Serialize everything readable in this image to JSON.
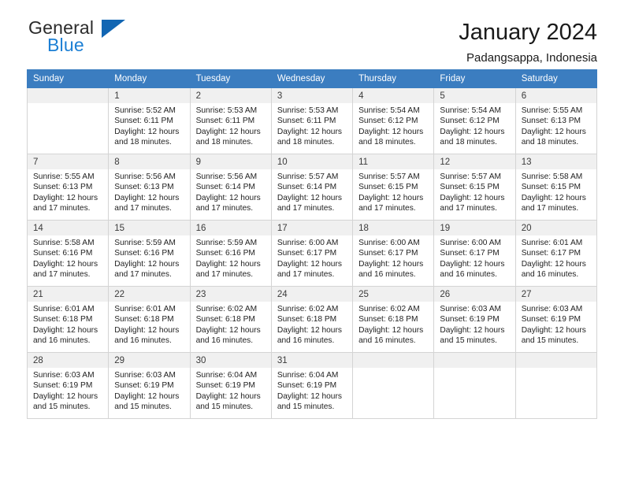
{
  "brand": {
    "name_top": "General",
    "name_bottom": "Blue",
    "triangle_color": "#1266b3",
    "blue_text_color": "#1c7fd4",
    "top_text_color": "#2b2b2b"
  },
  "header": {
    "title": "January 2024",
    "subtitle": "Padangsappa, Indonesia"
  },
  "theme": {
    "header_row_bg": "#3b7dc0",
    "header_row_text": "#ffffff",
    "daynum_bg": "#f0f0f0",
    "cell_border": "#d4d4d4",
    "cell_bg": "#ffffff"
  },
  "weekdays": [
    "Sunday",
    "Monday",
    "Tuesday",
    "Wednesday",
    "Thursday",
    "Friday",
    "Saturday"
  ],
  "labels": {
    "sunrise_prefix": "Sunrise:",
    "sunset_prefix": "Sunset:",
    "daylight_prefix": "Daylight:"
  },
  "weeks": [
    [
      {
        "day": "",
        "sunrise": "",
        "sunset": "",
        "daylight": ""
      },
      {
        "day": "1",
        "sunrise": "Sunrise: 5:52 AM",
        "sunset": "Sunset: 6:11 PM",
        "daylight": "Daylight: 12 hours and 18 minutes."
      },
      {
        "day": "2",
        "sunrise": "Sunrise: 5:53 AM",
        "sunset": "Sunset: 6:11 PM",
        "daylight": "Daylight: 12 hours and 18 minutes."
      },
      {
        "day": "3",
        "sunrise": "Sunrise: 5:53 AM",
        "sunset": "Sunset: 6:11 PM",
        "daylight": "Daylight: 12 hours and 18 minutes."
      },
      {
        "day": "4",
        "sunrise": "Sunrise: 5:54 AM",
        "sunset": "Sunset: 6:12 PM",
        "daylight": "Daylight: 12 hours and 18 minutes."
      },
      {
        "day": "5",
        "sunrise": "Sunrise: 5:54 AM",
        "sunset": "Sunset: 6:12 PM",
        "daylight": "Daylight: 12 hours and 18 minutes."
      },
      {
        "day": "6",
        "sunrise": "Sunrise: 5:55 AM",
        "sunset": "Sunset: 6:13 PM",
        "daylight": "Daylight: 12 hours and 18 minutes."
      }
    ],
    [
      {
        "day": "7",
        "sunrise": "Sunrise: 5:55 AM",
        "sunset": "Sunset: 6:13 PM",
        "daylight": "Daylight: 12 hours and 17 minutes."
      },
      {
        "day": "8",
        "sunrise": "Sunrise: 5:56 AM",
        "sunset": "Sunset: 6:13 PM",
        "daylight": "Daylight: 12 hours and 17 minutes."
      },
      {
        "day": "9",
        "sunrise": "Sunrise: 5:56 AM",
        "sunset": "Sunset: 6:14 PM",
        "daylight": "Daylight: 12 hours and 17 minutes."
      },
      {
        "day": "10",
        "sunrise": "Sunrise: 5:57 AM",
        "sunset": "Sunset: 6:14 PM",
        "daylight": "Daylight: 12 hours and 17 minutes."
      },
      {
        "day": "11",
        "sunrise": "Sunrise: 5:57 AM",
        "sunset": "Sunset: 6:15 PM",
        "daylight": "Daylight: 12 hours and 17 minutes."
      },
      {
        "day": "12",
        "sunrise": "Sunrise: 5:57 AM",
        "sunset": "Sunset: 6:15 PM",
        "daylight": "Daylight: 12 hours and 17 minutes."
      },
      {
        "day": "13",
        "sunrise": "Sunrise: 5:58 AM",
        "sunset": "Sunset: 6:15 PM",
        "daylight": "Daylight: 12 hours and 17 minutes."
      }
    ],
    [
      {
        "day": "14",
        "sunrise": "Sunrise: 5:58 AM",
        "sunset": "Sunset: 6:16 PM",
        "daylight": "Daylight: 12 hours and 17 minutes."
      },
      {
        "day": "15",
        "sunrise": "Sunrise: 5:59 AM",
        "sunset": "Sunset: 6:16 PM",
        "daylight": "Daylight: 12 hours and 17 minutes."
      },
      {
        "day": "16",
        "sunrise": "Sunrise: 5:59 AM",
        "sunset": "Sunset: 6:16 PM",
        "daylight": "Daylight: 12 hours and 17 minutes."
      },
      {
        "day": "17",
        "sunrise": "Sunrise: 6:00 AM",
        "sunset": "Sunset: 6:17 PM",
        "daylight": "Daylight: 12 hours and 17 minutes."
      },
      {
        "day": "18",
        "sunrise": "Sunrise: 6:00 AM",
        "sunset": "Sunset: 6:17 PM",
        "daylight": "Daylight: 12 hours and 16 minutes."
      },
      {
        "day": "19",
        "sunrise": "Sunrise: 6:00 AM",
        "sunset": "Sunset: 6:17 PM",
        "daylight": "Daylight: 12 hours and 16 minutes."
      },
      {
        "day": "20",
        "sunrise": "Sunrise: 6:01 AM",
        "sunset": "Sunset: 6:17 PM",
        "daylight": "Daylight: 12 hours and 16 minutes."
      }
    ],
    [
      {
        "day": "21",
        "sunrise": "Sunrise: 6:01 AM",
        "sunset": "Sunset: 6:18 PM",
        "daylight": "Daylight: 12 hours and 16 minutes."
      },
      {
        "day": "22",
        "sunrise": "Sunrise: 6:01 AM",
        "sunset": "Sunset: 6:18 PM",
        "daylight": "Daylight: 12 hours and 16 minutes."
      },
      {
        "day": "23",
        "sunrise": "Sunrise: 6:02 AM",
        "sunset": "Sunset: 6:18 PM",
        "daylight": "Daylight: 12 hours and 16 minutes."
      },
      {
        "day": "24",
        "sunrise": "Sunrise: 6:02 AM",
        "sunset": "Sunset: 6:18 PM",
        "daylight": "Daylight: 12 hours and 16 minutes."
      },
      {
        "day": "25",
        "sunrise": "Sunrise: 6:02 AM",
        "sunset": "Sunset: 6:18 PM",
        "daylight": "Daylight: 12 hours and 16 minutes."
      },
      {
        "day": "26",
        "sunrise": "Sunrise: 6:03 AM",
        "sunset": "Sunset: 6:19 PM",
        "daylight": "Daylight: 12 hours and 15 minutes."
      },
      {
        "day": "27",
        "sunrise": "Sunrise: 6:03 AM",
        "sunset": "Sunset: 6:19 PM",
        "daylight": "Daylight: 12 hours and 15 minutes."
      }
    ],
    [
      {
        "day": "28",
        "sunrise": "Sunrise: 6:03 AM",
        "sunset": "Sunset: 6:19 PM",
        "daylight": "Daylight: 12 hours and 15 minutes."
      },
      {
        "day": "29",
        "sunrise": "Sunrise: 6:03 AM",
        "sunset": "Sunset: 6:19 PM",
        "daylight": "Daylight: 12 hours and 15 minutes."
      },
      {
        "day": "30",
        "sunrise": "Sunrise: 6:04 AM",
        "sunset": "Sunset: 6:19 PM",
        "daylight": "Daylight: 12 hours and 15 minutes."
      },
      {
        "day": "31",
        "sunrise": "Sunrise: 6:04 AM",
        "sunset": "Sunset: 6:19 PM",
        "daylight": "Daylight: 12 hours and 15 minutes."
      },
      {
        "day": "",
        "sunrise": "",
        "sunset": "",
        "daylight": ""
      },
      {
        "day": "",
        "sunrise": "",
        "sunset": "",
        "daylight": ""
      },
      {
        "day": "",
        "sunrise": "",
        "sunset": "",
        "daylight": ""
      }
    ]
  ]
}
